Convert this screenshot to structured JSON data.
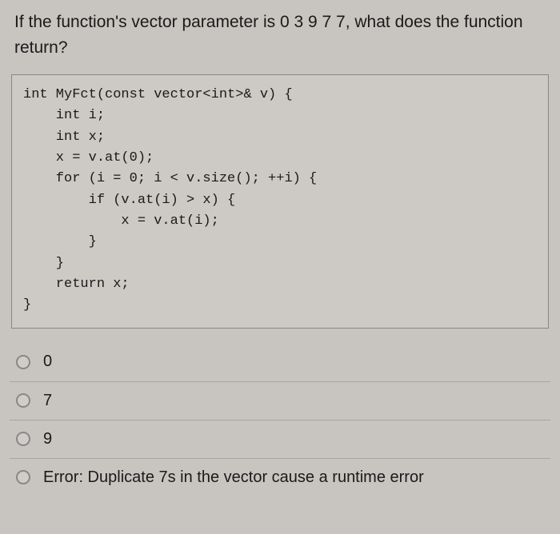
{
  "question": "If the function's vector parameter is 0 3 9 7 7, what does the function return?",
  "code": "int MyFct(const vector<int>& v) {\n    int i;\n    int x;\n    x = v.at(0);\n    for (i = 0; i < v.size(); ++i) {\n        if (v.at(i) > x) {\n            x = v.at(i);\n        }\n    }\n    return x;\n}",
  "options": [
    {
      "label": "0"
    },
    {
      "label": "7"
    },
    {
      "label": "9"
    },
    {
      "label": "Error: Duplicate 7s in the vector cause a runtime error"
    }
  ]
}
